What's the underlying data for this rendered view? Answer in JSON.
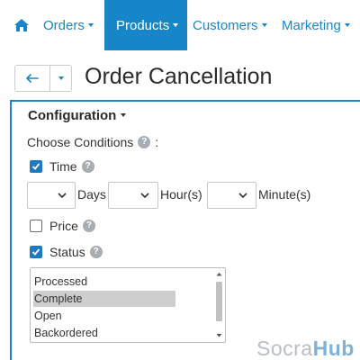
{
  "nav": {
    "home_icon": "home-icon",
    "items": [
      {
        "label": "Orders"
      },
      {
        "label": "Products"
      },
      {
        "label": "Customers"
      },
      {
        "label": "Marketing"
      }
    ],
    "accent": "#1786c9"
  },
  "header": {
    "back_icon": "arrow-left-icon",
    "title": "Order Cancellation"
  },
  "config": {
    "title": "Configuration",
    "choose_label": "Choose Conditions",
    "choose_colon": ":",
    "help_glyph": "?",
    "time": {
      "label": "Time",
      "checked": true
    },
    "duration": {
      "days_value": "",
      "days_label": "Days",
      "hours_value": "",
      "hours_label": "Hour(s)",
      "minutes_value": "",
      "minutes_label": "Minute(s)"
    },
    "price": {
      "label": "Price",
      "checked": false
    },
    "status": {
      "label": "Status",
      "checked": true,
      "options": [
        "Processed",
        "Complete",
        "Open",
        "Backordered"
      ],
      "selected": "Complete"
    }
  },
  "watermark": {
    "part1": "Socra",
    "part2": "Hub"
  }
}
